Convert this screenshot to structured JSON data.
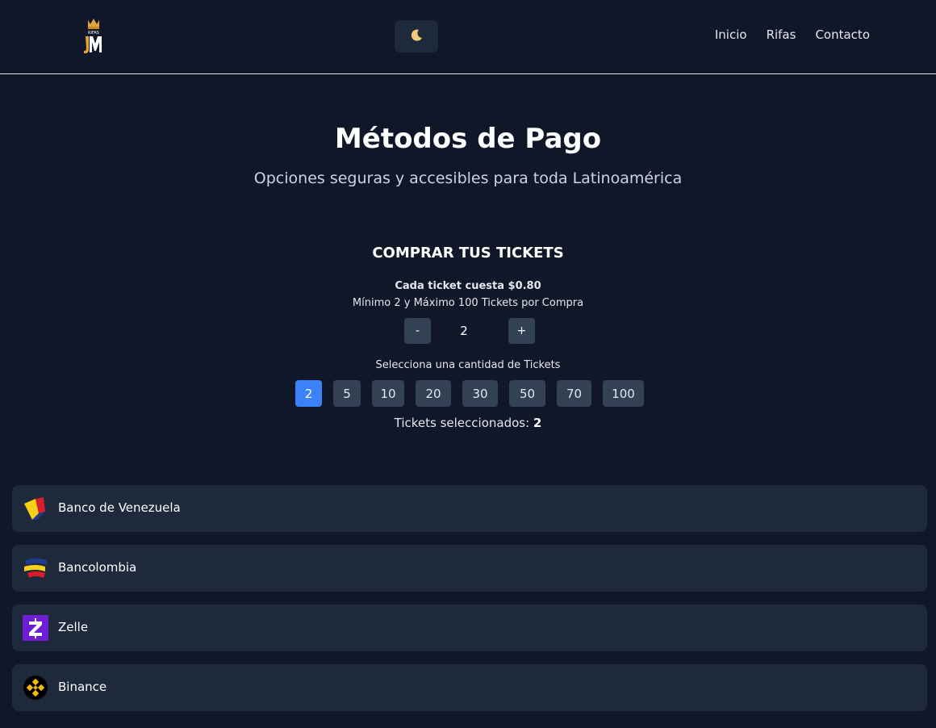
{
  "header": {
    "logo_alt": "Rifas JM",
    "theme_icon": "moon-icon",
    "nav": [
      "Inicio",
      "Rifas",
      "Contacto"
    ]
  },
  "hero": {
    "title": "Métodos de Pago",
    "subtitle": "Opciones seguras y accesibles para toda Latinoamérica"
  },
  "tickets": {
    "heading": "COMPRAR TUS TICKETS",
    "price": "Cada ticket cuesta $0.80",
    "limits": "Mínimo 2 y Máximo 100 Tickets por Compra",
    "minus_label": "-",
    "plus_label": "+",
    "quantity": "2",
    "select_label": "Selecciona una cantidad de Tickets",
    "options": [
      "2",
      "5",
      "10",
      "20",
      "30",
      "50",
      "70",
      "100"
    ],
    "selected_index": 0,
    "selected_prefix": "Tickets seleccionados: ",
    "selected_value": "2"
  },
  "methods": [
    {
      "label": "Banco de Venezuela",
      "icon": "banco-venezuela-icon"
    },
    {
      "label": "Bancolombia",
      "icon": "bancolombia-icon"
    },
    {
      "label": "Zelle",
      "icon": "zelle-icon"
    },
    {
      "label": "Binance",
      "icon": "binance-icon"
    }
  ],
  "colors": {
    "background": "#0f1729",
    "card": "#1e293b",
    "button": "#334155",
    "accent": "#3b82f6"
  }
}
